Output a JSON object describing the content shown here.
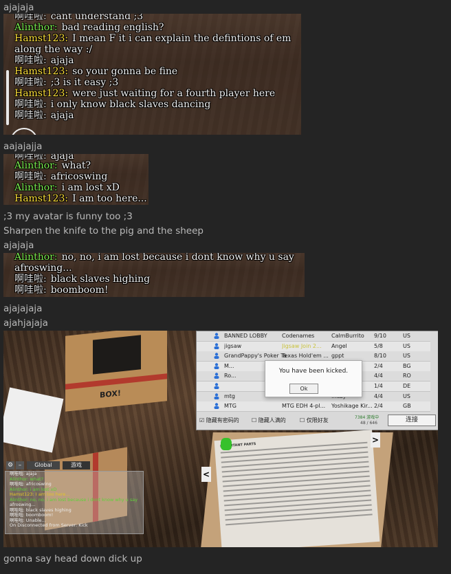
{
  "messages": {
    "m1": "ajajaja",
    "m2": "aajajajja",
    "m3": ";3 my avatar is funny too ;3",
    "m4": "Sharpen the knife to the pig and the sheep",
    "m5": "ajajaja",
    "m6": "ajajajaja",
    "m7": "ajahjajaja",
    "m8": "gonna say head down dick up"
  },
  "chat1": {
    "top_partial": "cant understand ;3",
    "lines": [
      {
        "name": "Alinthor:",
        "text": "bad reading english?"
      },
      {
        "name": "Hamst123:",
        "text": "I mean F it i can explain the defintions of em"
      },
      {
        "name": "",
        "text": "along the way :/"
      },
      {
        "name": "啊哇啦:",
        "text": "ajaja"
      },
      {
        "name": "Hamst123:",
        "text": "so your gonna be fine"
      },
      {
        "name": "啊哇啦:",
        "text": ";3 is it easy ;3"
      },
      {
        "name": "Hamst123:",
        "text": "were just waiting for a fourth player here"
      },
      {
        "name": "啊哇啦:",
        "text": "i only know black slaves dancing"
      },
      {
        "name": "啊哇啦:",
        "text": "ajaja"
      }
    ]
  },
  "chat2": {
    "top_partial": "ajaja",
    "lines": [
      {
        "name": "Alinthor:",
        "text": "what?"
      },
      {
        "name": "啊哇啦:",
        "text": "africoswing"
      },
      {
        "name": "Alinthor:",
        "text": "i am lost xD"
      },
      {
        "name": "Hamst123:",
        "text": "I am too here..."
      }
    ]
  },
  "chat3": {
    "lines": [
      {
        "name": "Alinthor:",
        "text": "no, no, i am lost because i dont know why u say"
      },
      {
        "name": "",
        "text": "afroswing..."
      },
      {
        "name": "啊哇啦:",
        "text": "black slaves highing"
      },
      {
        "name": "啊哇啦:",
        "text": "boomboom!"
      }
    ]
  },
  "game": {
    "lobby_rows": [
      {
        "name": "BANNED LOBBY",
        "game": "Codenames",
        "host": "CalmBurrito",
        "players": "9/10",
        "region": "US"
      },
      {
        "name": "jigsaw",
        "game": "Jigsaw Join 2...",
        "host": "Angel",
        "players": "5/8",
        "region": "US"
      },
      {
        "name": "GrandPappy's Poker Ta...",
        "game": "Texas Hold'em ...",
        "host": "gppt",
        "players": "8/10",
        "region": "US"
      },
      {
        "name": "M...",
        "game": "",
        "host": "...nar",
        "players": "2/4",
        "region": "BG"
      },
      {
        "name": "Ro...",
        "game": "",
        "host": "...u",
        "players": "4/4",
        "region": "RO"
      },
      {
        "name": "",
        "game": "",
        "host": "...lhe...",
        "players": "1/4",
        "region": "DE"
      },
      {
        "name": "mtg",
        "game": "",
        "host": "...azy",
        "players": "4/4",
        "region": "US"
      },
      {
        "name": "MTG",
        "game": "MTG EDH 4-pl...",
        "host": "Yoshikage Kir...",
        "players": "2/4",
        "region": "GB"
      }
    ],
    "kicked_text": "You have been kicked.",
    "ok_label": "Ok",
    "filter1": "隐藏有密码的",
    "filter2": "隐藏人满的",
    "filter3": "仅限好友",
    "count_line1": "7384 游戏中",
    "count_line2": "48 / 646",
    "connect_label": "连接",
    "box_label": "BOX!",
    "paper_title": "IMPORTANT PARTS",
    "mini_tab1": "Global",
    "mini_tab2": "游戏",
    "mini_lines": [
      "啊哇啦: ajaja",
      "Alinthor: what?",
      "啊哇啦: africoswing",
      "Alinthor: i am lost xD",
      "Hamst123: I am too here...",
      "Alinthor: no, no, i am lost because i dont know why u say",
      "afroswing...",
      "啊哇啦: black slaves highing",
      "啊哇啦: boomboom!",
      "啊哇啦: Unable...",
      "On Disconnected from Server: Kick"
    ],
    "colors": {
      "green": "#7ff051",
      "yellow": "#ffe03a"
    }
  }
}
